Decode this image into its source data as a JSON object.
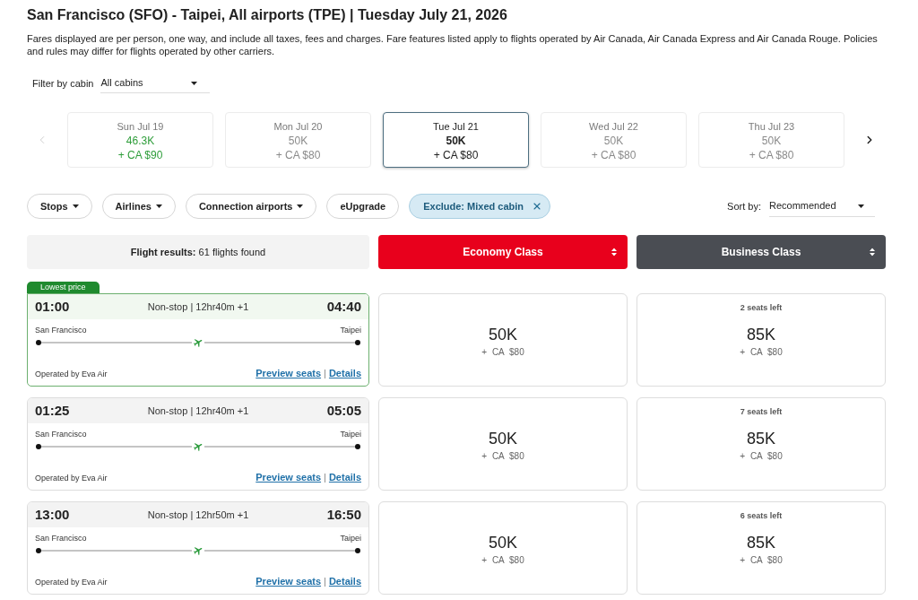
{
  "header": {
    "title": "San Francisco (SFO) - Taipei, All airports (TPE) | Tuesday July 21, 2026",
    "description": "Fares displayed are per person, one way, and include all taxes, fees and charges. Fare features listed apply to flights operated by Air Canada, Air Canada Express and Air Canada Rouge. Policies and rules may differ for flights operated by other carriers."
  },
  "cabin_filter": {
    "label": "Filter by cabin",
    "value": "All cabins"
  },
  "date_carousel": {
    "prev_arrow": {
      "disabled": true
    },
    "next_arrow": {
      "disabled": false
    },
    "dates": [
      {
        "day": "Sun Jul 19",
        "points": "46.3K",
        "fee": "+ CA $90",
        "lower_price": true,
        "selected": false
      },
      {
        "day": "Mon Jul 20",
        "points": "50K",
        "fee": "+ CA $80",
        "lower_price": false,
        "selected": false
      },
      {
        "day": "Tue Jul 21",
        "points": "50K",
        "fee": "+ CA $80",
        "lower_price": false,
        "selected": true
      },
      {
        "day": "Wed Jul 22",
        "points": "50K",
        "fee": "+ CA $80",
        "lower_price": false,
        "selected": false
      },
      {
        "day": "Thu Jul 23",
        "points": "50K",
        "fee": "+ CA $80",
        "lower_price": false,
        "selected": false
      }
    ]
  },
  "filters": [
    {
      "kind": "dropdown",
      "label": "Stops"
    },
    {
      "kind": "dropdown",
      "label": "Airlines"
    },
    {
      "kind": "dropdown",
      "label": "Connection airports"
    },
    {
      "kind": "button",
      "label": "eUpgrade"
    },
    {
      "kind": "chip",
      "label": "Exclude: Mixed cabin"
    }
  ],
  "sort": {
    "label": "Sort by:",
    "value": "Recommended"
  },
  "results_summary": "**Flight results:** 61 flights found",
  "cabin_columns": [
    {
      "label": "Economy Class",
      "color": "#e8001c"
    },
    {
      "label": "Business Class",
      "color": "#4a4d53"
    }
  ],
  "flights": [
    {
      "badge": "Lowest price",
      "highlighted": true,
      "departure": "01:00",
      "summary": "Non-stop | 12hr40m +1",
      "arrival": "04:40",
      "origin": "San Francisco",
      "destination": "Taipei",
      "operator": "Operated by Eva Air",
      "links": [
        "Preview seats",
        "Details"
      ],
      "separator": "|",
      "fares": [
        {
          "price": "50K",
          "fee": "+ CA $80"
        },
        {
          "seats_left": "2 seats left",
          "price": "85K",
          "fee": "+ CA $80"
        }
      ]
    },
    {
      "highlighted": false,
      "departure": "01:25",
      "summary": "Non-stop | 12hr40m +1",
      "arrival": "05:05",
      "origin": "San Francisco",
      "destination": "Taipei",
      "operator": "Operated by Eva Air",
      "links": [
        "Preview seats",
        "Details"
      ],
      "separator": "|",
      "fares": [
        {
          "price": "50K",
          "fee": "+ CA $80"
        },
        {
          "seats_left": "7 seats left",
          "price": "85K",
          "fee": "+ CA $80"
        }
      ]
    },
    {
      "highlighted": false,
      "departure": "13:00",
      "summary": "Non-stop | 12hr50m +1",
      "arrival": "16:50",
      "origin": "San Francisco",
      "destination": "Taipei",
      "operator": "Operated by Eva Air",
      "links": [
        "Preview seats",
        "Details"
      ],
      "separator": "|",
      "fares": [
        {
          "price": "50K",
          "fee": "+ CA $80"
        },
        {
          "seats_left": "6 seats left",
          "price": "85K",
          "fee": "+ CA $80"
        }
      ]
    }
  ]
}
